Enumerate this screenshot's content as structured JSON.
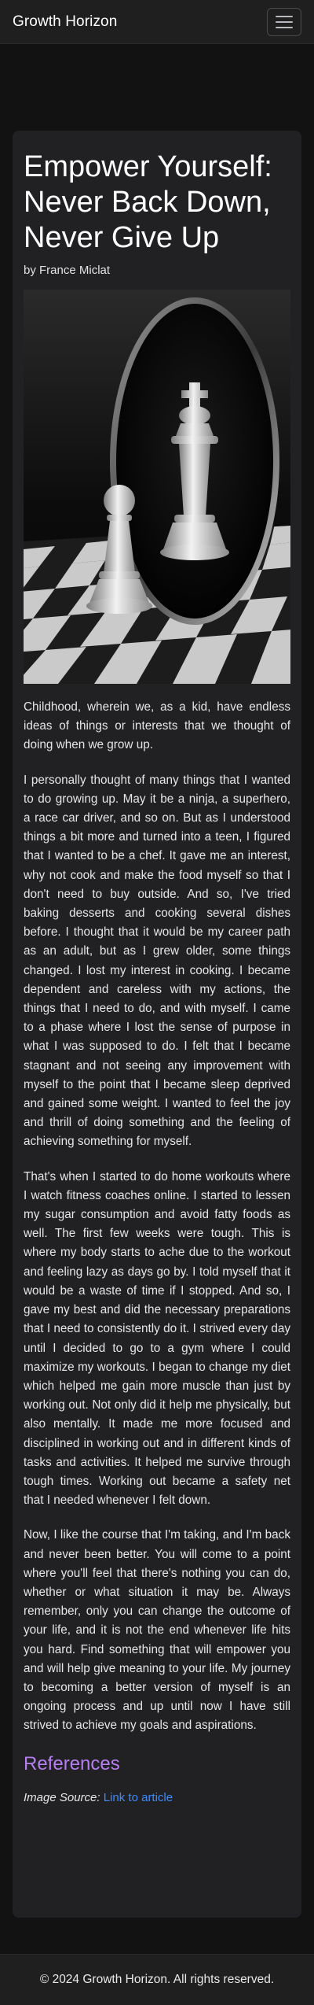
{
  "navbar": {
    "brand": "Growth Horizon",
    "toggle_icon": "hamburger-menu-icon"
  },
  "post": {
    "title": "Empower Yourself: Never Back Down, Never Give Up",
    "author": "by France Miclat",
    "image_icon": "pawn-mirror-king-illustration",
    "paragraphs": [
      "Childhood, wherein we, as a kid, have endless ideas of things or interests that we thought of doing when we grow up.",
      "I personally thought of many things that I wanted to do growing up. May it be a ninja, a superhero, a race car driver, and so on. But as I understood things a bit more and turned into a teen, I figured that I wanted to be a chef. It gave me an interest, why not cook and make the food myself so that I don't need to buy outside. And so, I've tried baking desserts and cooking several dishes before. I thought that it would be my career path as an adult, but as I grew older, some things changed. I lost my interest in cooking. I became dependent and careless with my actions, the things that I need to do, and with myself. I came to a phase where I lost the sense of purpose in what I was supposed to do. I felt that I became stagnant and not seeing any improvement with myself to the point that I became sleep deprived and gained some weight. I wanted to feel the joy and thrill of doing something and the feeling of achieving something for myself.",
      "That's when I started to do home workouts where I watch fitness coaches online. I started to lessen my sugar consumption and avoid fatty foods as well. The first few weeks were tough. This is where my body starts to ache due to the workout and feeling lazy as days go by. I told myself that it would be a waste of time if I stopped. And so, I gave my best and did the necessary preparations that I need to consistently do it. I strived every day until I decided to go to a gym where I could maximize my workouts. I began to change my diet which helped me gain more muscle than just by working out. Not only did it help me physically, but also mentally. It made me more focused and disciplined in working out and in different kinds of tasks and activities. It helped me survive through tough times. Working out became a safety net that I needed whenever I felt down.",
      "Now, I like the course that I'm taking, and I'm back and never been better. You will come to a point where you'll feel that there's nothing you can do, whether or what situation it may be. Always remember, only you can change the outcome of your life, and it is not the end whenever life hits you hard. Find something that will empower you and will help give meaning to your life. My journey to becoming a better version of myself is an ongoing process and up until now I have still strived to achieve my goals and aspirations."
    ]
  },
  "references": {
    "heading": "References",
    "source_label": "Image Source:",
    "link_text": "Link to article",
    "link_color": "#3d8bfd",
    "heading_color": "#b57ff0"
  },
  "footer": {
    "text": "© 2024 Growth Horizon. All rights reserved."
  }
}
